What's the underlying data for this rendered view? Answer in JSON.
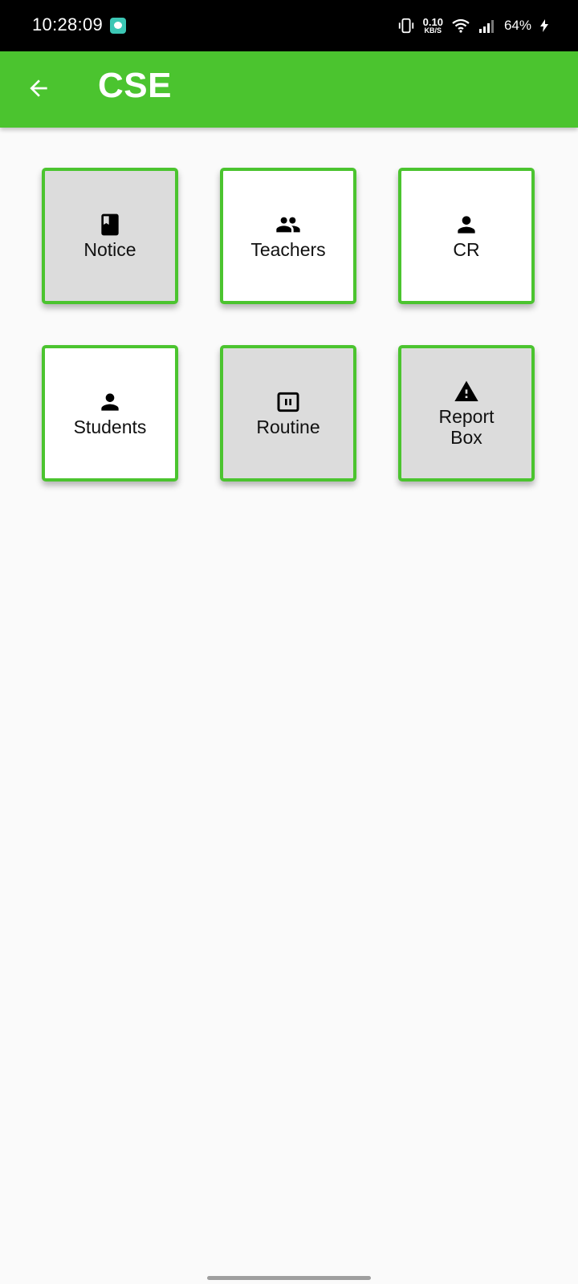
{
  "status_bar": {
    "time": "10:28:09",
    "net_speed_value": "0.10",
    "net_speed_unit": "KB/S",
    "battery": "64%"
  },
  "app_bar": {
    "title": "CSE",
    "back_icon": "arrow-back-icon",
    "background_color": "#4bc42f"
  },
  "tiles": [
    {
      "label": "Notice",
      "icon": "book-icon"
    },
    {
      "label": "Teachers",
      "icon": "people-icon"
    },
    {
      "label": "CR",
      "icon": "person-icon"
    },
    {
      "label": "Students",
      "icon": "person-icon"
    },
    {
      "label": "Routine",
      "icon": "pause-box-icon"
    },
    {
      "label": "Report Box",
      "icon": "warning-icon"
    }
  ],
  "colors": {
    "accent": "#4bc42f",
    "tile_pressed": "#dcdcdc",
    "tile_normal": "#ffffff"
  }
}
